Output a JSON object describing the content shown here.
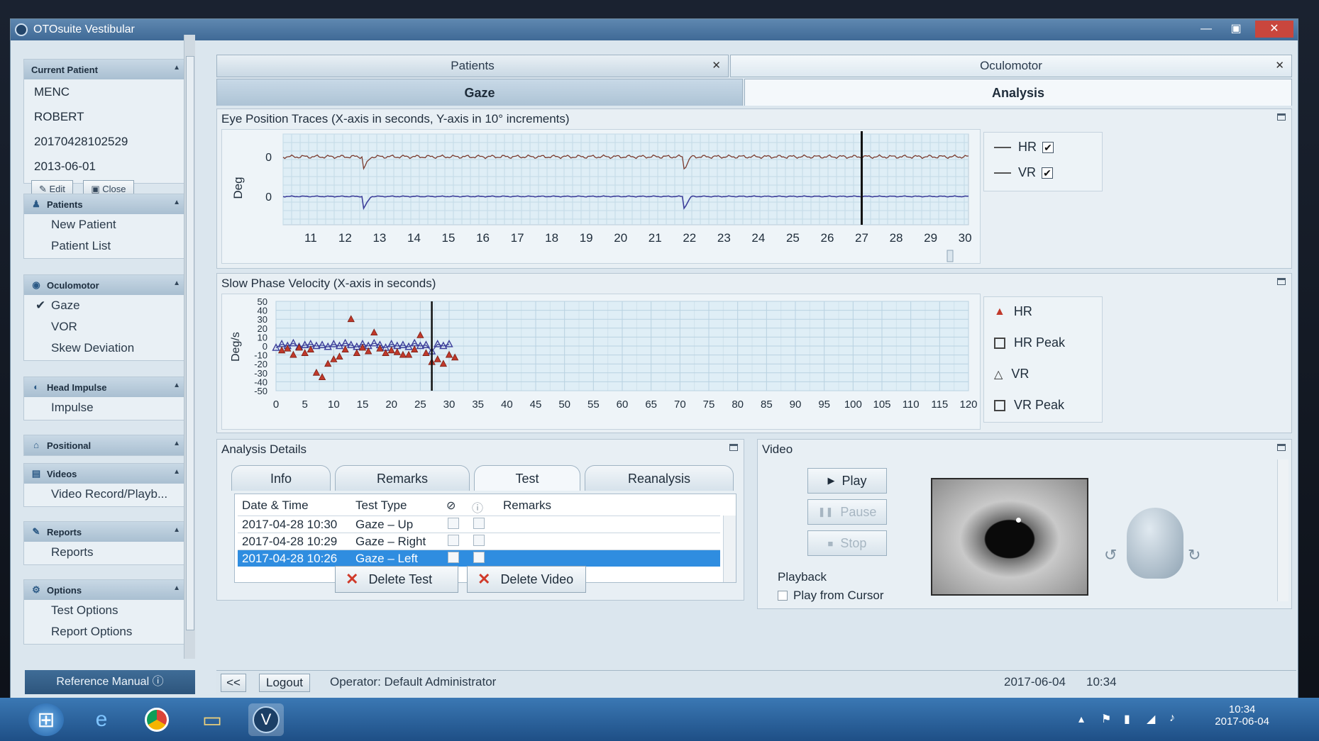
{
  "window": {
    "title": "OTOsuite Vestibular"
  },
  "sidebar": {
    "current_patient": {
      "header": "Current Patient",
      "lines": [
        "MENC",
        "ROBERT",
        "20170428102529",
        "2013-06-01"
      ],
      "edit_label": "Edit",
      "close_label": "Close"
    },
    "groups": [
      {
        "header": "Patients",
        "items": [
          "New Patient",
          "Patient List"
        ]
      },
      {
        "header": "Oculomotor",
        "items": [
          "Gaze",
          "VOR",
          "Skew Deviation"
        ]
      },
      {
        "header": "Head Impulse",
        "items": [
          "Impulse"
        ]
      },
      {
        "header": "Positional",
        "items": []
      },
      {
        "header": "Videos",
        "items": [
          "Video Record/Playb..."
        ]
      },
      {
        "header": "Reports",
        "items": [
          "Reports"
        ]
      },
      {
        "header": "Options",
        "items": [
          "Test Options",
          "Report Options"
        ]
      }
    ],
    "reference_manual": "Reference Manual"
  },
  "doc_tabs": [
    "Patients",
    "Oculomotor"
  ],
  "sub_tabs": [
    "Gaze",
    "Analysis"
  ],
  "eye_trace": {
    "title": "Eye Position Traces (X-axis in seconds, Y-axis in 10° increments)",
    "y_label": "Deg",
    "y_ticks": [
      "0",
      "0"
    ],
    "x_ticks": [
      "11",
      "12",
      "13",
      "14",
      "15",
      "16",
      "17",
      "18",
      "19",
      "20",
      "21",
      "22",
      "23",
      "24",
      "25",
      "26",
      "27",
      "28",
      "29",
      "30"
    ],
    "legend": [
      "HR",
      "VR"
    ],
    "legend_checked": [
      true,
      true
    ],
    "cursor_x": 27,
    "colors": {
      "hr": "#7a3b2e",
      "vr": "#3d3f9a"
    }
  },
  "spv": {
    "title": "Slow Phase Velocity (X-axis in seconds)",
    "y_label": "Deg/s",
    "legend": [
      "HR",
      "HR Peak",
      "VR",
      "VR Peak"
    ]
  },
  "chart_data": {
    "type": "scatter",
    "xlim": [
      0,
      120
    ],
    "ylim": [
      -50,
      50
    ],
    "x_ticks": [
      "0",
      "5",
      "10",
      "15",
      "20",
      "25",
      "30",
      "35",
      "40",
      "45",
      "50",
      "55",
      "60",
      "65",
      "70",
      "75",
      "80",
      "85",
      "90",
      "95",
      "100",
      "105",
      "110",
      "115",
      "120"
    ],
    "y_ticks": [
      "50",
      "40",
      "30",
      "20",
      "10",
      "0",
      "-10",
      "-20",
      "-30",
      "-40",
      "-50"
    ],
    "cursor_x": 27,
    "series": [
      {
        "name": "HR",
        "color": "#c0392b",
        "points": [
          [
            1,
            -5
          ],
          [
            2,
            -3
          ],
          [
            3,
            -10
          ],
          [
            4,
            -2
          ],
          [
            5,
            -8
          ],
          [
            6,
            -4
          ],
          [
            7,
            -30
          ],
          [
            8,
            -35
          ],
          [
            9,
            -20
          ],
          [
            10,
            -15
          ],
          [
            11,
            -12
          ],
          [
            12,
            -4
          ],
          [
            13,
            30
          ],
          [
            14,
            -8
          ],
          [
            15,
            -2
          ],
          [
            16,
            -6
          ],
          [
            17,
            15
          ],
          [
            18,
            -3
          ],
          [
            19,
            -8
          ],
          [
            20,
            -5
          ],
          [
            21,
            -7
          ],
          [
            22,
            -10
          ],
          [
            23,
            -10
          ],
          [
            24,
            -4
          ],
          [
            25,
            12
          ],
          [
            26,
            -8
          ],
          [
            27,
            -18
          ],
          [
            28,
            -15
          ],
          [
            29,
            -20
          ],
          [
            30,
            -10
          ],
          [
            31,
            -13
          ]
        ]
      },
      {
        "name": "VR",
        "color": "#3d3f9a",
        "points": [
          [
            0,
            -2
          ],
          [
            1,
            2
          ],
          [
            2,
            0
          ],
          [
            3,
            3
          ],
          [
            4,
            -1
          ],
          [
            5,
            1
          ],
          [
            6,
            2
          ],
          [
            7,
            0
          ],
          [
            8,
            1
          ],
          [
            9,
            -1
          ],
          [
            10,
            2
          ],
          [
            11,
            0
          ],
          [
            12,
            3
          ],
          [
            13,
            1
          ],
          [
            14,
            -1
          ],
          [
            15,
            2
          ],
          [
            16,
            0
          ],
          [
            17,
            3
          ],
          [
            18,
            1
          ],
          [
            19,
            -2
          ],
          [
            20,
            2
          ],
          [
            21,
            0
          ],
          [
            22,
            1
          ],
          [
            23,
            -1
          ],
          [
            24,
            3
          ],
          [
            25,
            0
          ],
          [
            26,
            1
          ],
          [
            27,
            -6
          ],
          [
            28,
            2
          ],
          [
            29,
            0
          ],
          [
            30,
            2
          ]
        ]
      }
    ]
  },
  "analysis": {
    "title": "Analysis Details",
    "tabs": [
      "Info",
      "Remarks",
      "Test",
      "Reanalysis"
    ],
    "columns": [
      "Date & Time",
      "Test Type",
      "Remarks"
    ],
    "rows": [
      {
        "date": "2017-04-28 10:30",
        "type": "Gaze – Up"
      },
      {
        "date": "2017-04-28 10:29",
        "type": "Gaze – Right"
      },
      {
        "date": "2017-04-28 10:26",
        "type": "Gaze – Left"
      }
    ],
    "delete_test": "Delete Test",
    "delete_video": "Delete Video"
  },
  "video": {
    "title": "Video",
    "play": "Play",
    "pause": "Pause",
    "stop": "Stop",
    "playback_label": "Playback",
    "play_from_cursor": "Play from Cursor"
  },
  "status": {
    "back": "<<",
    "logout": "Logout",
    "operator": "Operator: Default Administrator",
    "date": "2017-06-04",
    "time": "10:34"
  },
  "taskbar": {
    "time": "10:34",
    "date": "2017-06-04"
  }
}
